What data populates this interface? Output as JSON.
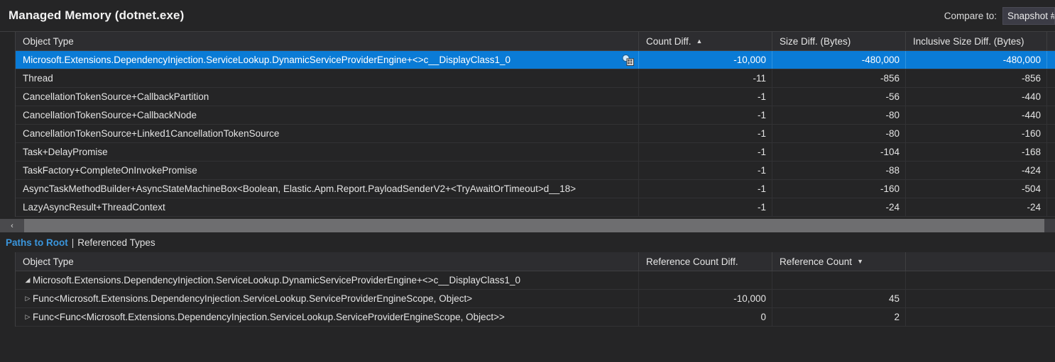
{
  "header": {
    "title": "Managed Memory (dotnet.exe)",
    "compare_label": "Compare to:",
    "snapshot_value": "Snapshot #"
  },
  "top_grid": {
    "columns": [
      {
        "label": "Object Type",
        "sort": ""
      },
      {
        "label": "Count Diff.",
        "sort": "▲"
      },
      {
        "label": "Size Diff. (Bytes)",
        "sort": ""
      },
      {
        "label": "Inclusive Size Diff. (Bytes)",
        "sort": ""
      }
    ],
    "rows": [
      {
        "type": "Microsoft.Extensions.DependencyInjection.ServiceLookup.DynamicServiceProviderEngine+<>c__DisplayClass1_0",
        "count": "-10,000",
        "size": "-480,000",
        "inclusive": "-480,000",
        "selected": true,
        "icon": "view-instances-icon"
      },
      {
        "type": "Thread",
        "count": "-11",
        "size": "-856",
        "inclusive": "-856",
        "selected": false
      },
      {
        "type": "CancellationTokenSource+CallbackPartition",
        "count": "-1",
        "size": "-56",
        "inclusive": "-440",
        "selected": false
      },
      {
        "type": "CancellationTokenSource+CallbackNode",
        "count": "-1",
        "size": "-80",
        "inclusive": "-440",
        "selected": false
      },
      {
        "type": "CancellationTokenSource+Linked1CancellationTokenSource",
        "count": "-1",
        "size": "-80",
        "inclusive": "-160",
        "selected": false
      },
      {
        "type": "Task+DelayPromise",
        "count": "-1",
        "size": "-104",
        "inclusive": "-168",
        "selected": false
      },
      {
        "type": "TaskFactory+CompleteOnInvokePromise",
        "count": "-1",
        "size": "-88",
        "inclusive": "-424",
        "selected": false
      },
      {
        "type": "AsyncTaskMethodBuilder+AsyncStateMachineBox<Boolean, Elastic.Apm.Report.PayloadSenderV2+<TryAwaitOrTimeout>d__18>",
        "count": "-1",
        "size": "-160",
        "inclusive": "-504",
        "selected": false
      },
      {
        "type": "LazyAsyncResult+ThreadContext",
        "count": "-1",
        "size": "-24",
        "inclusive": "-24",
        "selected": false
      }
    ]
  },
  "scrollbar": {
    "left_arrow": "‹"
  },
  "tabs": {
    "active": "Paths to Root",
    "separator": "|",
    "inactive": "Referenced Types"
  },
  "bottom_grid": {
    "columns": [
      {
        "label": "Object Type",
        "sort": ""
      },
      {
        "label": "Reference Count Diff.",
        "sort": ""
      },
      {
        "label": "Reference Count",
        "sort": "▼"
      }
    ],
    "rows": [
      {
        "expander": "◢",
        "expander_state": "expanded",
        "indent": 0,
        "type": "Microsoft.Extensions.DependencyInjection.ServiceLookup.DynamicServiceProviderEngine+<>c__DisplayClass1_0",
        "ref_diff": "",
        "ref_count": ""
      },
      {
        "expander": "▷",
        "expander_state": "collapsed",
        "indent": 1,
        "type": "Func<Microsoft.Extensions.DependencyInjection.ServiceLookup.ServiceProviderEngineScope, Object>",
        "ref_diff": "-10,000",
        "ref_count": "45"
      },
      {
        "expander": "▷",
        "expander_state": "collapsed",
        "indent": 1,
        "type": "Func<Func<Microsoft.Extensions.DependencyInjection.ServiceLookup.ServiceProviderEngineScope, Object>>",
        "ref_diff": "0",
        "ref_count": "2"
      }
    ]
  },
  "colors": {
    "background": "#252526",
    "header_row": "#2d2d30",
    "selection": "#0a7bd6",
    "accent_link": "#3a96dd",
    "grid_line": "#3f3f41",
    "scrollbar_thumb": "#6e6e70"
  }
}
